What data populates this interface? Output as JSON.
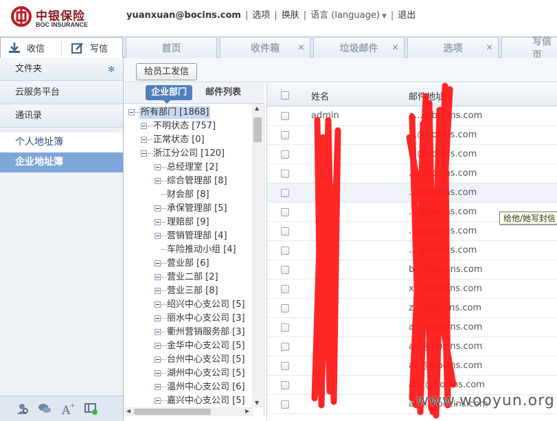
{
  "header": {
    "logo_cn": "中银保险",
    "logo_en": "BOC INSURANCE",
    "user_email": "yuanxuan@bocins.com",
    "links": [
      "选项",
      "换肤",
      "语言 (language)",
      "退出"
    ]
  },
  "toolbar": {
    "receive_label": "收信",
    "write_label": "写信",
    "tabs": [
      {
        "label": "首页",
        "closable": false
      },
      {
        "label": "收件箱",
        "closable": true
      },
      {
        "label": "垃圾邮件",
        "closable": true
      },
      {
        "label": "选项",
        "closable": true
      },
      {
        "label": "写信页",
        "closable": false
      }
    ]
  },
  "sidebar": {
    "items": [
      "文件夹",
      "云服务平台",
      "通讯录"
    ],
    "sub_items": [
      "个人地址簿",
      "企业地址簿"
    ],
    "active_sub": "企业地址簿"
  },
  "main": {
    "send_staff_button": "给员工发信",
    "tree_tabs": [
      "企业部门",
      "邮件列表"
    ],
    "tree": [
      {
        "label": "所有部门 [1868]",
        "level": 0,
        "toggle": true
      },
      {
        "label": "不明状态 [757]",
        "level": 1,
        "toggle": true
      },
      {
        "label": "正常状态 [0]",
        "level": 1,
        "toggle": true
      },
      {
        "label": "浙江分公司 [120]",
        "level": 1,
        "toggle": true
      },
      {
        "label": "总经理室 [2]",
        "level": 2,
        "toggle": true
      },
      {
        "label": "综合管理部 [8]",
        "level": 2,
        "toggle": true
      },
      {
        "label": "财会部 [8]",
        "level": 2,
        "toggle": false
      },
      {
        "label": "承保管理部 [5]",
        "level": 2,
        "toggle": true
      },
      {
        "label": "理赔部 [9]",
        "level": 2,
        "toggle": true
      },
      {
        "label": "营销管理部 [4]",
        "level": 2,
        "toggle": true
      },
      {
        "label": "车险推动小组 [4]",
        "level": 2,
        "toggle": false
      },
      {
        "label": "营业部 [6]",
        "level": 2,
        "toggle": true
      },
      {
        "label": "营业二部 [2]",
        "level": 2,
        "toggle": true
      },
      {
        "label": "营业三部 [8]",
        "level": 2,
        "toggle": true
      },
      {
        "label": "绍兴中心支公司 [5]",
        "level": 2,
        "toggle": true
      },
      {
        "label": "丽水中心支公司 [3]",
        "level": 2,
        "toggle": true
      },
      {
        "label": "衢州营销服务部 [3]",
        "level": 2,
        "toggle": true
      },
      {
        "label": "金华中心支公司 [5]",
        "level": 2,
        "toggle": true
      },
      {
        "label": "台州中心支公司 [5]",
        "level": 2,
        "toggle": true
      },
      {
        "label": "湖州中心支公司 [5]",
        "level": 2,
        "toggle": true
      },
      {
        "label": "温州中心支公司 [6]",
        "level": 2,
        "toggle": true
      },
      {
        "label": "嘉兴中心支公司 [5]",
        "level": 2,
        "toggle": true
      }
    ],
    "list_headers": {
      "name": "姓名",
      "email": "邮件地址"
    },
    "contacts": [
      {
        "name": "admin",
        "email": "a...@bocins.com"
      },
      {
        "name": "",
        "email": "...@bocins.com"
      },
      {
        "name": "",
        "email": "...@bocins.com"
      },
      {
        "name": "",
        "email": "...@bocins.com"
      },
      {
        "name": "",
        "email": "...@bocins.com"
      },
      {
        "name": "",
        "email": "...@bocins.com"
      },
      {
        "name": "",
        "email": "...@bocins.com"
      },
      {
        "name": "",
        "email": "...@bocins.com"
      },
      {
        "name": "",
        "email": "b...@bocins.com"
      },
      {
        "name": "",
        "email": "x...@bocins.com"
      },
      {
        "name": "",
        "email": "z...@bocins.com"
      },
      {
        "name": "",
        "email": "a...@bocins.com"
      },
      {
        "name": "",
        "email": "a...@bocins.com"
      },
      {
        "name": "",
        "email": "a...@bocins.com"
      },
      {
        "name": "",
        "email": "al...@bocins.com"
      },
      {
        "name": "",
        "email": "an...@bocins.com"
      }
    ],
    "hovered_row": 4,
    "tooltip": "给他/她写封信"
  },
  "watermark": "www.wooyun.org",
  "colors": {
    "brand_red": "#b81c22",
    "active_nav": "#7fa6d8",
    "tab_active": "#4f7fbd",
    "redaction": "#ff1a1a"
  }
}
